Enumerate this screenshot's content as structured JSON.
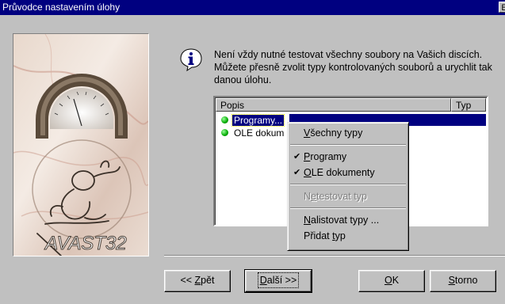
{
  "window": {
    "title": "Průvodce nastavením úlohy",
    "title_button": "E"
  },
  "brand": {
    "logo_text": "AVAST32"
  },
  "info": {
    "text": "Není vždy nutné testovat všechny soubory na Vašich discích. Můžete přesně zvolit typy kontrolovaných souborů a urychlit tak danou úlohu."
  },
  "list": {
    "columns": [
      "Popis",
      "Typ"
    ],
    "rows": [
      {
        "label": "Programy...",
        "selected": true
      },
      {
        "label": "OLE dokum",
        "selected": false
      }
    ]
  },
  "context_menu": {
    "items": [
      {
        "label_pre": "",
        "label_u": "V",
        "label_post": "šechny typy",
        "checked": false,
        "disabled": false
      },
      {
        "separator": true
      },
      {
        "label_pre": "",
        "label_u": "P",
        "label_post": "rogramy",
        "checked": true,
        "disabled": false
      },
      {
        "label_pre": "",
        "label_u": "O",
        "label_post": "LE dokumenty",
        "checked": true,
        "disabled": false
      },
      {
        "separator": true
      },
      {
        "label_pre": "N",
        "label_u": "e",
        "label_post": "testovat typ",
        "checked": false,
        "disabled": true
      },
      {
        "separator": true
      },
      {
        "label_pre": "",
        "label_u": "N",
        "label_post": "alistovat typy ...",
        "checked": false,
        "disabled": false
      },
      {
        "label_pre": "Přidat ",
        "label_u": "t",
        "label_post": "yp",
        "checked": false,
        "disabled": false
      }
    ]
  },
  "buttons": {
    "back": {
      "pre": "<< ",
      "u": "Z",
      "post": "pět"
    },
    "next": {
      "pre": "",
      "u": "D",
      "post": "alší >>"
    },
    "ok": {
      "pre": "",
      "u": "O",
      "post": "K"
    },
    "cancel": {
      "pre": "",
      "u": "S",
      "post": "torno"
    }
  },
  "icons": {
    "info": "info-icon",
    "list_bullet": "green-dot-icon",
    "check": "check-icon"
  },
  "colors": {
    "titlebar": "#000080",
    "selection": "#000080",
    "face": "#c0c0c0"
  }
}
